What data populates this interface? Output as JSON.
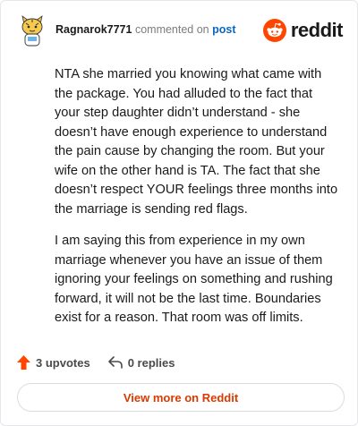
{
  "comment": {
    "username": "Ragnarok7771",
    "action_text": "commented on",
    "post_link": "post",
    "paragraphs": [
      "NTA she married you knowing what came with the package. You had alluded to the fact that your step daughter didn’t understand - she doesn’t have enough experience to understand the pain cause by changing the room. But your wife on the other hand is TA. The fact that she doesn’t respect YOUR feelings three months into the marriage is sending red flags.",
      "I am saying this from experience in my own marriage whenever you have an issue of them ignoring your feelings on something and rushing forward, it will not be the last time. Boundaries exist for a reason. That room was off limits."
    ]
  },
  "brand": {
    "name": "reddit",
    "icon": "reddit-logo-icon"
  },
  "footer": {
    "upvotes_label": "3 upvotes",
    "replies_label": "0 replies",
    "upvote_icon": "upvote-arrow-icon",
    "reply_icon": "reply-arrow-icon"
  },
  "view_more_label": "View more on Reddit",
  "colors": {
    "accent": "#d93a00",
    "reddit_orange": "#ff4500",
    "link": "#0a66c2",
    "text": "#1a1a1b"
  }
}
